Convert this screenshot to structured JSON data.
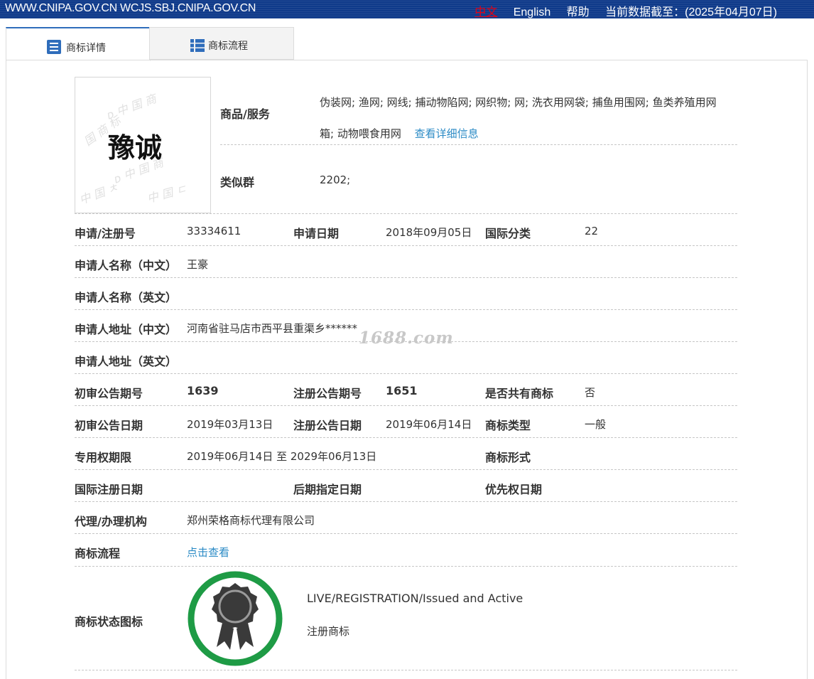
{
  "topbar": {
    "site_url": "WWW.CNIPA.GOV.CN WCJS.SBJ.CNIPA.GOV.CN",
    "lang_zh": "中文",
    "lang_en": "English",
    "help": "帮助",
    "data_cutoff": "当前数据截至：(2025年04月07日)"
  },
  "tabs": [
    {
      "label": "商标详情",
      "icon": "detail-list-icon",
      "active": true
    },
    {
      "label": "商标流程",
      "icon": "grid-list-icon",
      "active": false
    }
  ],
  "trademark_image": {
    "text": "豫诚"
  },
  "goods_services": {
    "label": "商品/服务",
    "line1": "伪装网; 渔网; 网线; 捕动物陷网; 网织物; 网; 洗衣用网袋; 捕鱼用围网; 鱼类养殖用网",
    "line2": "箱; 动物喂食用网",
    "detail_link": "查看详细信息"
  },
  "similar_group": {
    "label": "类似群",
    "value": "2202;"
  },
  "fields": {
    "reg_no_label": "申请/注册号",
    "reg_no": "33334611",
    "app_date_label": "申请日期",
    "app_date": "2018年09月05日",
    "intl_class_label": "国际分类",
    "intl_class": "22",
    "applicant_cn_label": "申请人名称（中文）",
    "applicant_cn": "王豪",
    "applicant_en_label": "申请人名称（英文）",
    "applicant_en": "",
    "address_cn_label": "申请人地址（中文）",
    "address_cn": "河南省驻马店市西平县重渠乡******",
    "address_en_label": "申请人地址（英文）",
    "address_en": "",
    "prelim_no_label": "初审公告期号",
    "prelim_no": "1639",
    "reg_pub_no_label": "注册公告期号",
    "reg_pub_no": "1651",
    "shared_label": "是否共有商标",
    "shared": "否",
    "prelim_date_label": "初审公告日期",
    "prelim_date": "2019年03月13日",
    "reg_pub_date_label": "注册公告日期",
    "reg_pub_date": "2019年06月14日",
    "tm_type_label": "商标类型",
    "tm_type": "一般",
    "exclusive_label": "专用权期限",
    "exclusive": "2019年06月14日 至 2029年06月13日",
    "tm_form_label": "商标形式",
    "tm_form": "",
    "intl_reg_date_label": "国际注册日期",
    "intl_reg_date": "",
    "later_date_label": "后期指定日期",
    "later_date": "",
    "priority_date_label": "优先权日期",
    "priority_date": "",
    "agent_label": "代理/办理机构",
    "agent": "郑州荣格商标代理有限公司",
    "process_label": "商标流程",
    "process_link": "点击查看",
    "status_label": "商标状态图标",
    "status_en": "LIVE/REGISTRATION/Issued and Active",
    "status_cn": "注册商标"
  },
  "overlay_watermark": "1688.com",
  "colors": {
    "topbar": "#0f3a8a",
    "link": "#2a8ac5",
    "status_ring": "#1e9b45",
    "status_medal": "#3a3a3a"
  }
}
